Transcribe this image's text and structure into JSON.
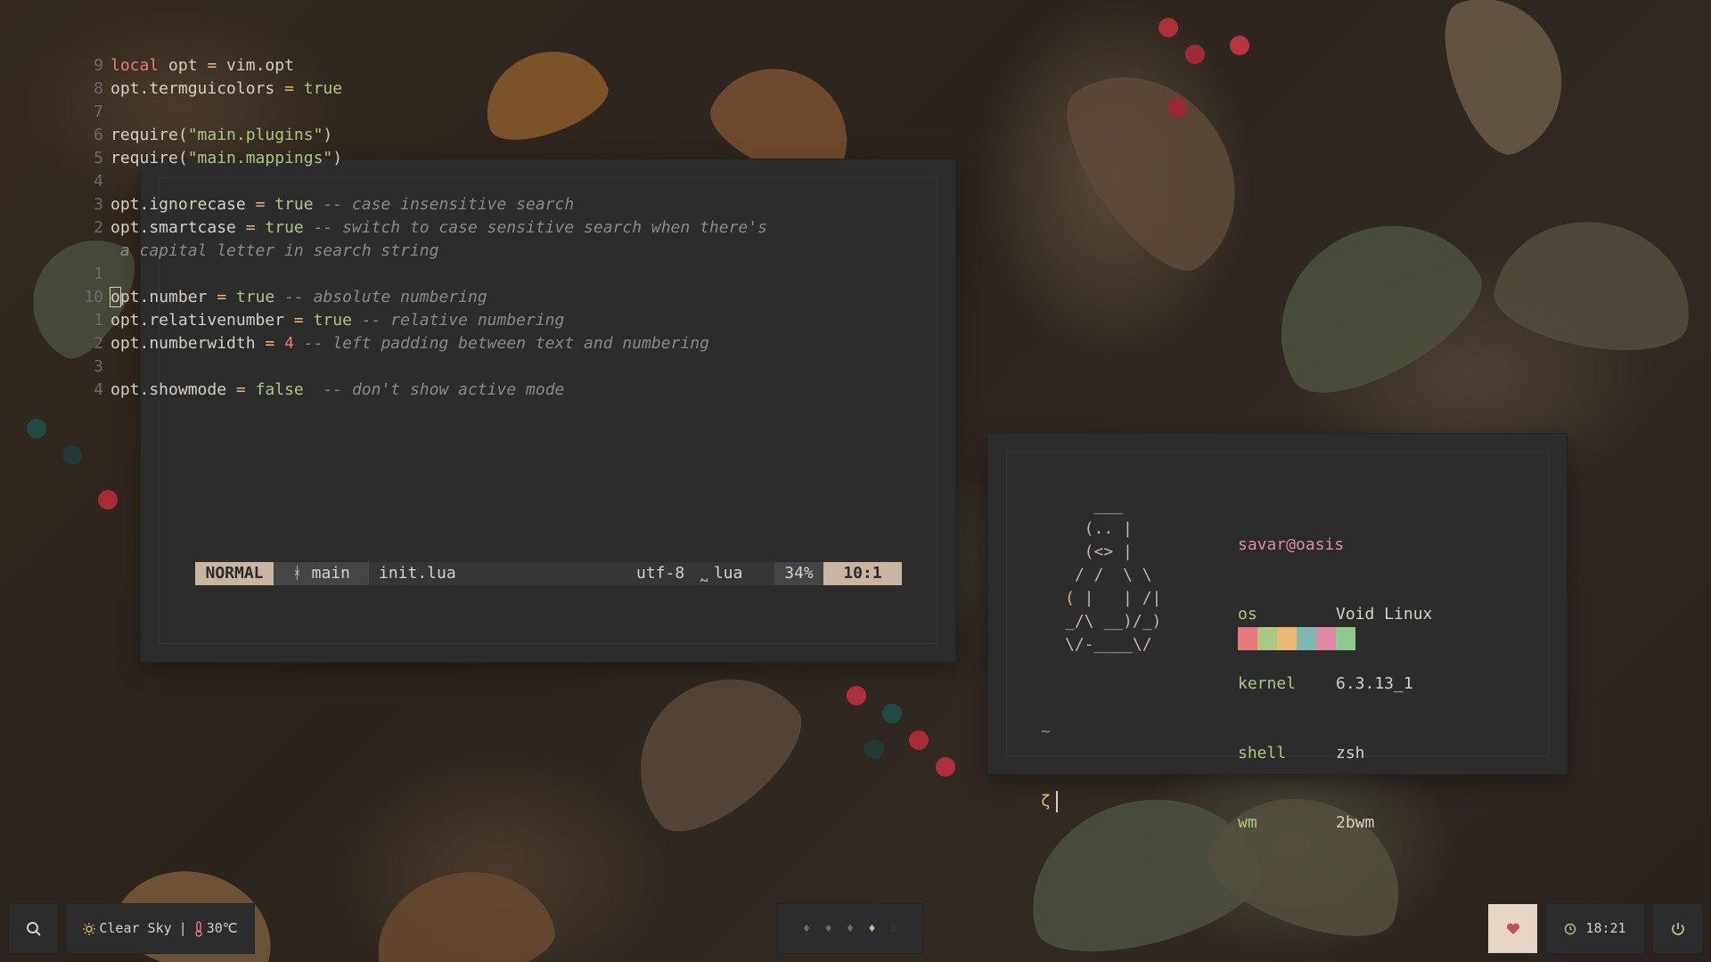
{
  "editor": {
    "lines": [
      {
        "num": "9",
        "tokens": [
          [
            "kw",
            "local"
          ],
          [
            "txt",
            " opt "
          ],
          [
            "op",
            "="
          ],
          [
            "txt",
            " vim.opt"
          ]
        ]
      },
      {
        "num": "8",
        "tokens": [
          [
            "txt",
            "opt.termguicolors "
          ],
          [
            "op",
            "="
          ],
          [
            "bool",
            " true"
          ]
        ]
      },
      {
        "num": "7",
        "tokens": []
      },
      {
        "num": "6",
        "tokens": [
          [
            "txt",
            "require("
          ],
          [
            "str",
            "\"main.plugins\""
          ],
          [
            "txt",
            ")"
          ]
        ]
      },
      {
        "num": "5",
        "tokens": [
          [
            "txt",
            "require("
          ],
          [
            "str",
            "\"main.mappings\""
          ],
          [
            "txt",
            ")"
          ]
        ]
      },
      {
        "num": "4",
        "tokens": []
      },
      {
        "num": "3",
        "tokens": [
          [
            "txt",
            "opt.ignorecase "
          ],
          [
            "op",
            "="
          ],
          [
            "bool",
            " true"
          ],
          [
            "cm",
            " -- case insensitive search"
          ]
        ]
      },
      {
        "num": "2",
        "tokens": [
          [
            "txt",
            "opt.smartcase "
          ],
          [
            "op",
            "="
          ],
          [
            "bool",
            " true"
          ],
          [
            "cm",
            " -- switch to case sensitive search when there's"
          ]
        ]
      },
      {
        "num": "",
        "tokens": [
          [
            "cm",
            " a capital letter in search string"
          ]
        ]
      },
      {
        "num": "1",
        "tokens": []
      },
      {
        "num": "10",
        "tokens": [
          [
            "cur",
            "o"
          ],
          [
            "txt",
            "pt.number "
          ],
          [
            "op",
            "="
          ],
          [
            "bool",
            " true"
          ],
          [
            "cm",
            " -- absolute numbering"
          ]
        ]
      },
      {
        "num": "1",
        "tokens": [
          [
            "txt",
            "opt.relativenumber "
          ],
          [
            "op",
            "="
          ],
          [
            "bool",
            " true"
          ],
          [
            "cm",
            " -- relative numbering"
          ]
        ]
      },
      {
        "num": "2",
        "tokens": [
          [
            "txt",
            "opt.numberwidth "
          ],
          [
            "op",
            "="
          ],
          [
            "num",
            " 4"
          ],
          [
            "cm",
            " -- left padding between text and numbering"
          ]
        ]
      },
      {
        "num": "3",
        "tokens": []
      },
      {
        "num": "4",
        "tokens": [
          [
            "txt",
            "opt.showmode "
          ],
          [
            "op",
            "="
          ],
          [
            "bool",
            " false"
          ],
          [
            "cm",
            "  -- don't show active mode"
          ]
        ]
      }
    ],
    "statusline": {
      "mode": "NORMAL",
      "branch": "ᚼ main",
      "file": "init.lua",
      "encoding": "utf-8",
      "filetype": "᷐ lua",
      "percent": "34%",
      "position": "10:1"
    }
  },
  "terminal": {
    "ascii_art": "   ___\n  (.. |\n  (<> |\n / /  \\ \\\n( |   | /|\n_/\\ __)/_)\n\\/-____\\/",
    "user_host": "savar@oasis",
    "info": [
      {
        "key": "os",
        "value": "Void Linux"
      },
      {
        "key": "kernel",
        "value": "6.3.13_1"
      },
      {
        "key": "shell",
        "value": "zsh"
      },
      {
        "key": "wm",
        "value": "2bwm"
      }
    ],
    "swatches": [
      "#e87b7b",
      "#a8c97f",
      "#e9b872",
      "#7fb8b0",
      "#e08aa8",
      "#8fc98f"
    ],
    "prompt_dir": "~",
    "prompt_symbol": "ζ"
  },
  "bar": {
    "weather_icon": "sun-icon",
    "weather_text": "Clear Sky",
    "separator": "|",
    "temp": "30℃",
    "workspaces": [
      "♦",
      "♦",
      "♦",
      "♦",
      "♢"
    ],
    "active_workspace": 3,
    "time": "18:21",
    "accent": "#a8c97f",
    "heart_color": "#c8505a"
  }
}
